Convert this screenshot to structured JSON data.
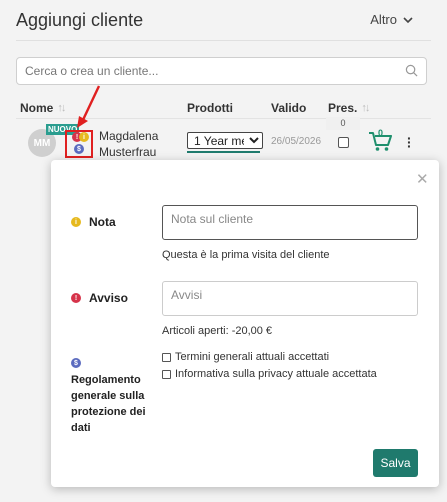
{
  "header": {
    "title": "Aggiungi cliente",
    "more_label": "Altro"
  },
  "search": {
    "placeholder": "Cerca o crea un cliente..."
  },
  "table": {
    "col_name": "Nome",
    "col_products": "Prodotti",
    "col_valid": "Valido",
    "col_pres": "Pres."
  },
  "customer": {
    "initials": "MM",
    "new_badge": "NUOVO",
    "first_name": "Magdalena",
    "last_name": "Musterfrau",
    "product": "1 Year mem",
    "valid_until": "26/05/2026",
    "presence_count": "0",
    "cart_count": "0"
  },
  "modal": {
    "note_label": "Nota",
    "note_placeholder": "Nota sul cliente",
    "first_visit_text": "Questa è la prima visita del cliente",
    "warning_label": "Avviso",
    "warning_placeholder": "Avvisi",
    "open_items_text": "Articoli aperti: -20,00 €",
    "privacy_label": "Regolamento generale sulla protezione dei dati",
    "terms_label": "Termini generali attuali accettati",
    "privacy_policy_label": "Informativa sulla privacy attuale accettata",
    "save_label": "Salva"
  },
  "colors": {
    "accent": "#1f7a6d",
    "warning_yellow": "#e6b91e",
    "alert_red": "#d6334a",
    "dollar_blue": "#5b6bbf",
    "highlight_red": "#e02020"
  }
}
